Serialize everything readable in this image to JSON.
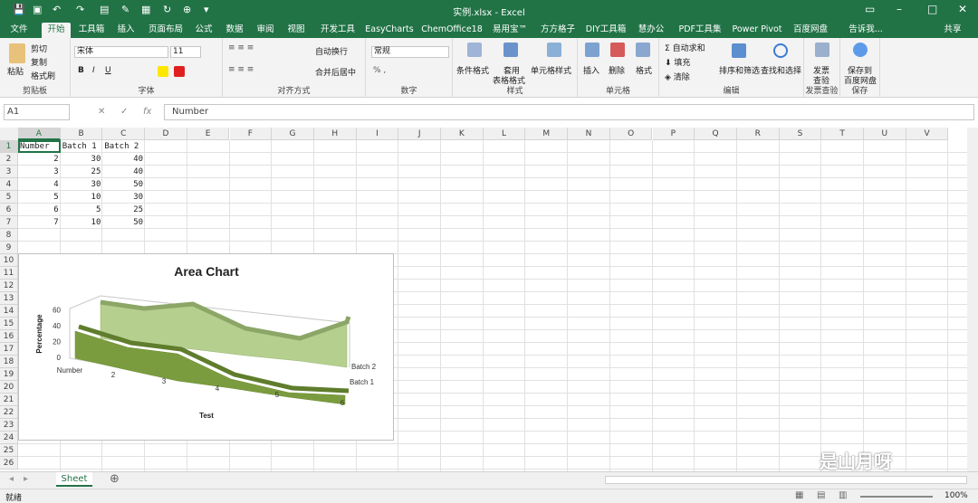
{
  "window": {
    "title": "实例.xlsx - Excel"
  },
  "tabs": [
    "文件",
    "开始",
    "工具箱",
    "插入",
    "页面布局",
    "公式",
    "数据",
    "审阅",
    "视图",
    "开发工具",
    "EasyCharts",
    "ChemOffice18",
    "易用宝™",
    "方方格子",
    "DIY工具箱",
    "慧办公",
    "PDF工具集",
    "Power Pivot",
    "百度网盘",
    "告诉我...",
    "共享"
  ],
  "ribbon": {
    "clipboard": {
      "paste": "粘贴",
      "cut": "剪切",
      "copy": "复制",
      "painter": "格式刷",
      "label": "剪贴板"
    },
    "font": {
      "name": "宋体",
      "size": "11",
      "bold": "B",
      "italic": "I",
      "underline": "U",
      "label": "字体"
    },
    "align": {
      "wrap": "自动换行",
      "merge": "合并后居中",
      "label": "对齐方式"
    },
    "number": {
      "format": "常规",
      "label": "数字"
    },
    "styles": {
      "cond": "条件格式",
      "table1": "套用",
      "table2": "表格格式",
      "cell": "单元格样式",
      "label": "样式"
    },
    "cells": {
      "insert": "插入",
      "delete": "删除",
      "format": "格式",
      "label": "单元格"
    },
    "edit": {
      "autosum": "自动求和",
      "fill": "填充",
      "clear": "清除",
      "sort": "排序和筛选",
      "find": "查找和选择",
      "label": "编辑"
    },
    "invoice": {
      "b1": "发票",
      "b2": "查验",
      "label": "发票查验"
    },
    "save": {
      "b1": "保存到",
      "b2": "百度网盘",
      "label": "保存"
    }
  },
  "formula": {
    "namebox": "A1",
    "content": "Number",
    "fx": "fx"
  },
  "columns": [
    "A",
    "B",
    "C",
    "D",
    "E",
    "F",
    "G",
    "H",
    "I",
    "J",
    "K",
    "L",
    "M",
    "N",
    "O",
    "P",
    "Q",
    "R",
    "S",
    "T",
    "U",
    "V"
  ],
  "rows": [
    "1",
    "2",
    "3",
    "4",
    "5",
    "6",
    "7",
    "8",
    "9",
    "10",
    "11",
    "12",
    "13",
    "14",
    "15",
    "16",
    "17",
    "18",
    "19",
    "20",
    "21",
    "22",
    "23",
    "24",
    "25",
    "26"
  ],
  "cells": [
    [
      "Number",
      "Batch 1",
      "Batch 2"
    ],
    [
      "2",
      "30",
      "40"
    ],
    [
      "3",
      "25",
      "40"
    ],
    [
      "4",
      "30",
      "50"
    ],
    [
      "5",
      "10",
      "30"
    ],
    [
      "6",
      "5",
      "25"
    ],
    [
      "7",
      "10",
      "50"
    ]
  ],
  "sheet_tab": "Sheet",
  "status": {
    "ready": "就绪",
    "zoom": "100%"
  },
  "watermark": "是山月呀",
  "chart_data": {
    "type": "area",
    "title": "Area Chart",
    "xlabel": "Test",
    "ylabel": "Percentage",
    "x": [
      "Number",
      "2",
      "3",
      "4",
      "5",
      "6"
    ],
    "yticks": [
      "0",
      "20",
      "40",
      "60"
    ],
    "ylim": [
      0,
      60
    ],
    "series": [
      {
        "name": "Batch 1",
        "values": [
          30,
          25,
          30,
          10,
          5,
          10
        ],
        "color": "#7b9c3e"
      },
      {
        "name": "Batch 2",
        "values": [
          40,
          40,
          50,
          30,
          25,
          50
        ],
        "color": "#b5cf8e"
      }
    ]
  }
}
